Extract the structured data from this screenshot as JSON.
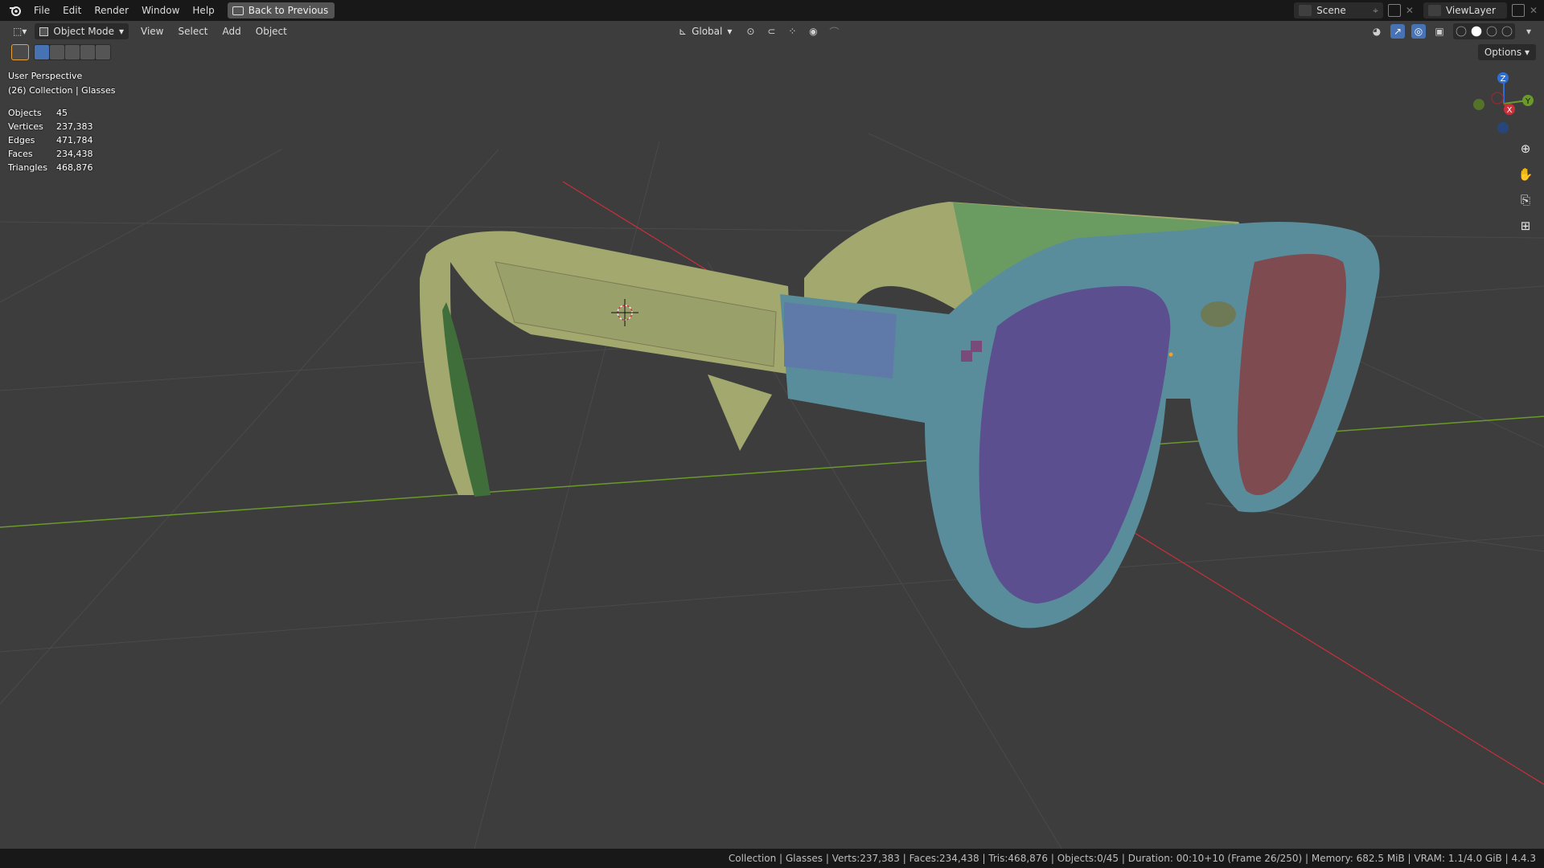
{
  "menubar": {
    "items": [
      "File",
      "Edit",
      "Render",
      "Window",
      "Help"
    ],
    "back_button": "Back to Previous",
    "scene": "Scene",
    "view_layer": "ViewLayer"
  },
  "viewport_header": {
    "mode": "Object Mode",
    "menus": [
      "View",
      "Select",
      "Add",
      "Object"
    ],
    "orientation": "Global",
    "options": "Options"
  },
  "overlay": {
    "view_name": "User Perspective",
    "collection": "(26) Collection | Glasses",
    "stats": [
      {
        "label": "Objects",
        "value": "45"
      },
      {
        "label": "Vertices",
        "value": "237,383"
      },
      {
        "label": "Edges",
        "value": "471,784"
      },
      {
        "label": "Faces",
        "value": "234,438"
      },
      {
        "label": "Triangles",
        "value": "468,876"
      }
    ]
  },
  "gizmo": {
    "z": "Z",
    "y": "Y",
    "x": "X"
  },
  "statusbar": {
    "text": "Collection | Glasses | Verts:237,383 | Faces:234,438 | Tris:468,876 | Objects:0/45 | Duration: 00:10+10 (Frame 26/250) | Memory: 682.5 MiB | VRAM: 1.1/4.0 GiB | 4.4.3"
  },
  "colors": {
    "frame_blue": "#5a8d9b",
    "lens_purple": "#5b4f8f",
    "lens_red": "#7d4b50",
    "temple_yellow": "#a3a86e",
    "temple_green": "#6a9c62",
    "axis_red": "#c8303a",
    "axis_green": "#6a9a2a"
  },
  "icons": [
    "blender-logo-icon",
    "scene-icon",
    "view-layer-icon",
    "cursor-icon",
    "pan-icon",
    "camera-icon",
    "grid-icon"
  ]
}
